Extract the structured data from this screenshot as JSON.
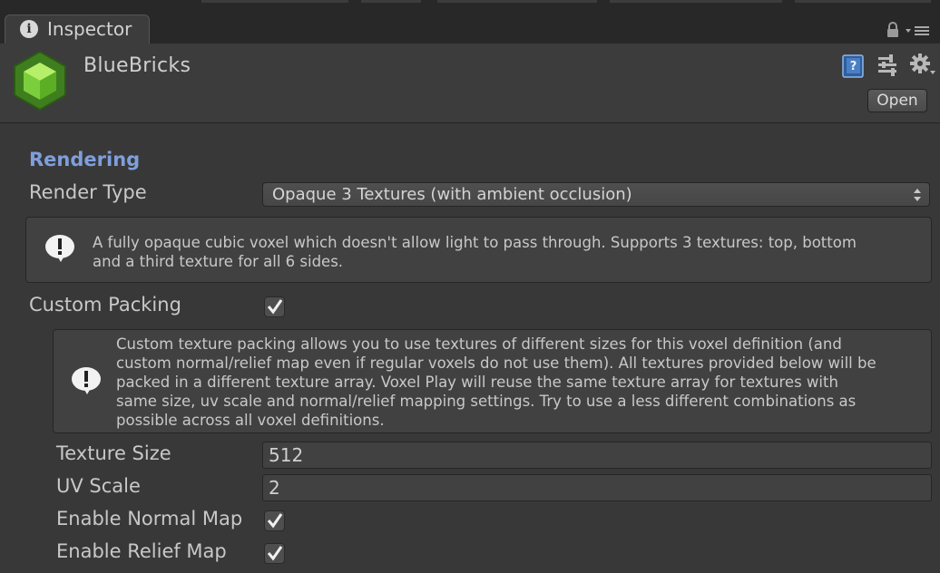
{
  "tab": {
    "label": "Inspector",
    "icon": "info-icon"
  },
  "header": {
    "asset_name": "BlueBricks",
    "asset_icon": "voxel-cube-icon",
    "open_label": "Open",
    "icon_color": "#7ccf3c"
  },
  "rendering": {
    "section_title": "Rendering",
    "render_type_label": "Render Type",
    "render_type_value": "Opaque 3 Textures (with ambient occlusion)",
    "render_help_line1": "A fully opaque cubic voxel which doesn't allow light to pass through. Supports 3 textures: top, bottom",
    "render_help_line2": "and a third texture for all 6 sides.",
    "custom_packing_label": "Custom Packing",
    "custom_packing_checked": true,
    "packing_help": [
      "Custom texture packing allows you to use textures of different sizes for this voxel definition (and",
      "custom normal/relief map even if regular voxels do not use them). All textures provided below will be",
      "packed in a different texture array. Voxel Play will reuse the same texture array for textures with",
      "same size, uv scale and normal/relief mapping settings. Try to use a less different combinations as",
      "possible across all voxel definitions."
    ],
    "texture_size_label": "Texture Size",
    "texture_size_value": "512",
    "uv_scale_label": "UV Scale",
    "uv_scale_value": "2",
    "enable_normal_map_label": "Enable Normal Map",
    "enable_normal_map_checked": true,
    "enable_relief_map_label": "Enable Relief Map",
    "enable_relief_map_checked": true
  },
  "colors": {
    "accent": "#7f9fdc",
    "background": "#383838"
  }
}
